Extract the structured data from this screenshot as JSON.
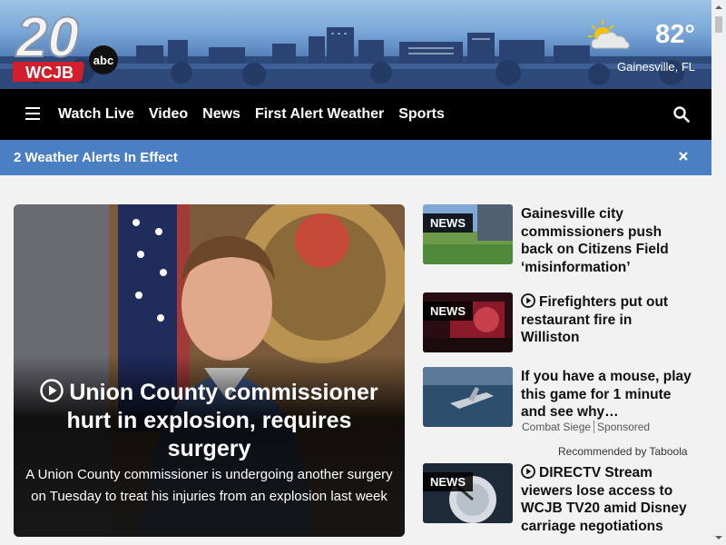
{
  "brand": {
    "channel_number": "20",
    "network": "abc",
    "station": "WCJB"
  },
  "weather": {
    "temperature": "82°",
    "location": "Gainesville, FL",
    "icon": "partly-cloudy-icon"
  },
  "nav": {
    "menu_icon": "hamburger-icon",
    "links": [
      "Watch Live",
      "Video",
      "News",
      "First Alert Weather",
      "Sports"
    ],
    "search_icon": "search-icon"
  },
  "alert": {
    "text": "2 Weather Alerts In Effect",
    "close_icon": "close-icon"
  },
  "hero": {
    "title": "Union County commissioner hurt in explosion, requires surgery",
    "summary": "A Union County commissioner is undergoing another surgery on Tuesday to treat his injuries from an explosion last week",
    "has_video": true
  },
  "stories": [
    {
      "badge": "NEWS",
      "headline": "Gainesville city commissioners push back on Citizens Field ‘misinformation’",
      "has_video": false
    },
    {
      "badge": "NEWS",
      "headline": "Firefighters put out restaurant fire in Williston",
      "has_video": true
    },
    {
      "badge": "",
      "headline": "If you have a mouse, play this game for 1 minute and see why…",
      "has_video": false,
      "sponsor_name": "Combat Siege",
      "sponsor_label": "Sponsored"
    },
    {
      "badge": "NEWS",
      "headline": "DIRECTV Stream viewers lose access to WCJB TV20 amid Disney carriage negotiations",
      "has_video": true
    }
  ],
  "taboola": "Recommended by Taboola",
  "colors": {
    "nav_bg": "#000000",
    "alert_bg": "#4a7fc4",
    "logo_red": "#d21f2b",
    "page_bg": "#f2f2f2"
  }
}
